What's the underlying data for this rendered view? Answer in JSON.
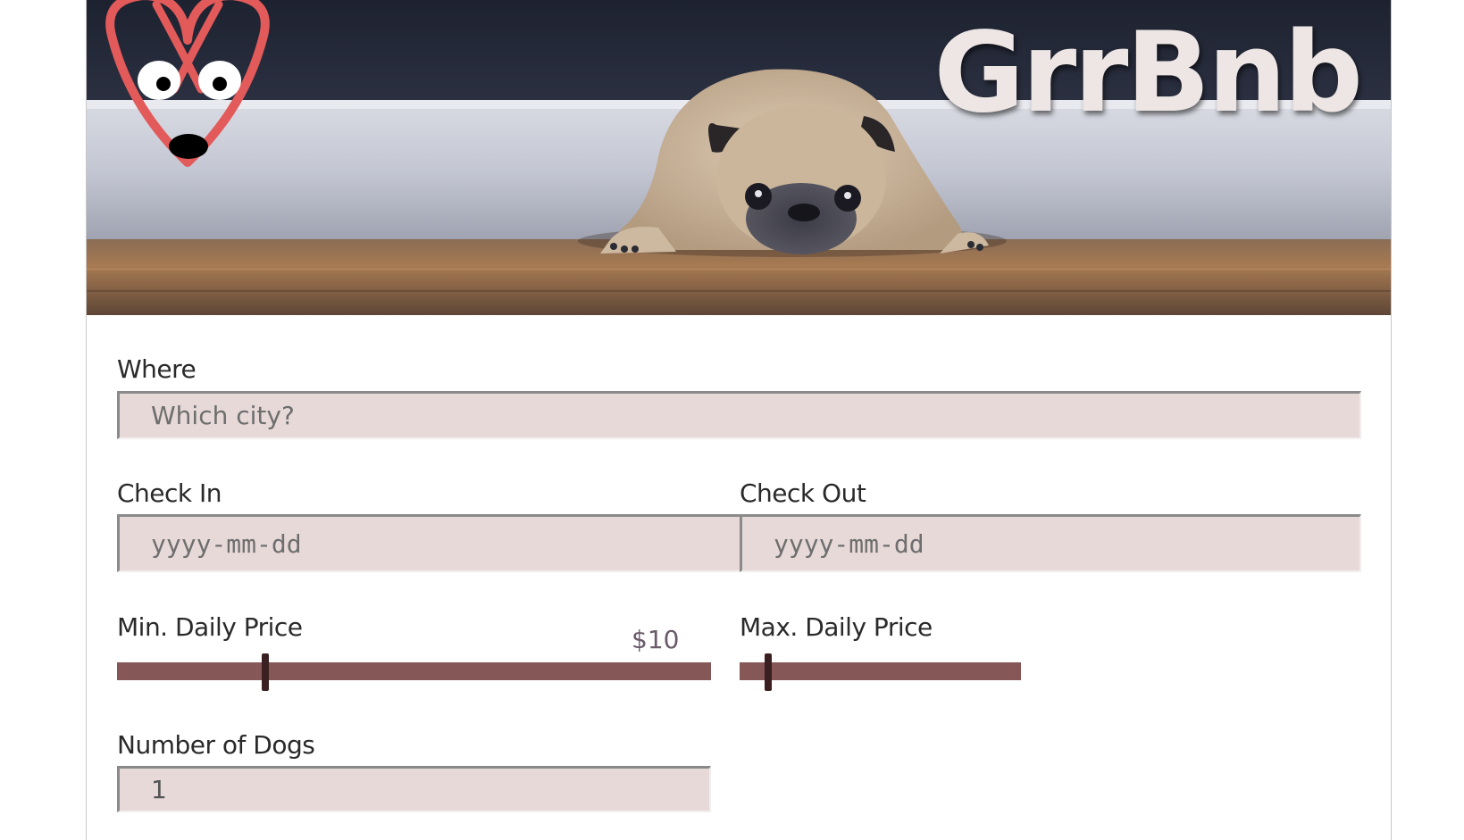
{
  "app": {
    "brand_name": "GrrBnb",
    "logo_icon": "dog-face-logo-icon",
    "hero_image": "sad-pug-on-floor",
    "colors": {
      "accent": "#855757",
      "input_bg": "#e8d9d9",
      "logo_stroke": "#e25a5a",
      "brand_text": "#eee6e5"
    }
  },
  "form": {
    "where": {
      "label": "Where",
      "placeholder": "Which city?",
      "value": ""
    },
    "check_in": {
      "label": "Check In",
      "placeholder": "yyyy-mm-dd"
    },
    "check_out": {
      "label": "Check Out",
      "placeholder": "yyyy-mm-dd"
    },
    "min_price": {
      "label": "Min. Daily Price",
      "value_display": "$10",
      "slider_level": 0.25
    },
    "max_price": {
      "label": "Max. Daily Price",
      "slider_level": 0.1
    },
    "dogs": {
      "label": "Number of Dogs",
      "value": "1"
    }
  }
}
